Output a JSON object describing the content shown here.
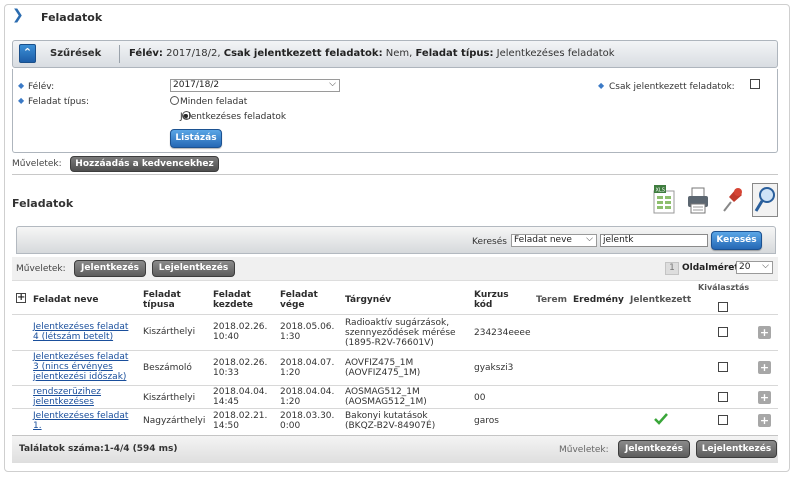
{
  "page": {
    "title": "Feladatok"
  },
  "filters": {
    "header_label": "Szűrések",
    "summary_parts": [
      {
        "k": "Félév:",
        "v": " 2017/18/2, "
      },
      {
        "k": "Csak jelentkezett feladatok:",
        "v": " Nem, "
      },
      {
        "k": "Feladat típus:",
        "v": " Jelentkezéses feladatok"
      }
    ],
    "semester_label": "Félév:",
    "semester_value": "2017/18/2",
    "type_label": "Feladat típus:",
    "type_options": [
      "Minden feladat",
      "Jelentkezéses feladatok"
    ],
    "selected_type_index": 1,
    "only_registered_label": "Csak jelentkezett feladatok:",
    "only_registered_checked": false,
    "list_button": "Listázás"
  },
  "operations_top": {
    "label": "Műveletek:",
    "favorite_button": "Hozzáadás a kedvencekhez"
  },
  "list": {
    "title": "Feladatok",
    "toolbar_icons": [
      "excel-export-icon",
      "print-icon",
      "pin-icon",
      "search-magnifier-icon"
    ],
    "search": {
      "label": "Keresés",
      "field_select": "Feladat neve",
      "query": "jelentk",
      "button": "Keresés"
    },
    "operations_label": "Műveletek:",
    "register_button": "Jelentkezés",
    "unregister_button": "Lejelentkezés",
    "page_number": "1",
    "page_size_label": "Oldalméret",
    "page_size": "20",
    "columns": {
      "name": "Feladat neve",
      "type": [
        "Feladat",
        "típusa"
      ],
      "start": [
        "Feladat",
        "kezdete"
      ],
      "end": [
        "Feladat",
        "vége"
      ],
      "subject": "Tárgynév",
      "course": [
        "Kurzus",
        "kód"
      ],
      "room": "Terem",
      "result": "Eredmény",
      "registered": "Jelentkezett",
      "select": "Kiválasztás"
    },
    "rows": [
      {
        "name": [
          "Jelentkezéses feladat",
          "4 (létszám betelt)"
        ],
        "type": "Kiszárthelyi",
        "start": [
          "2018.02.26.",
          "10:40"
        ],
        "end": [
          "2018.05.06.",
          "1:30"
        ],
        "subject": [
          "Radioaktív sugárzások,",
          "szennyeződések mérése",
          "(1895-R2V-76601V)"
        ],
        "course": "234234eeee",
        "registered": false
      },
      {
        "name": [
          "Jelentkezéses feladat",
          "3 (nincs érvényes",
          "jelentkezési időszak)"
        ],
        "type": "Beszámoló",
        "start": [
          "2018.02.26.",
          "10:33"
        ],
        "end": [
          "2018.04.07.",
          "1:20"
        ],
        "subject": [
          "AOVFIZ475_1M",
          "(AOVFIZ475_1M)"
        ],
        "course": "gyakszi3",
        "registered": false
      },
      {
        "name": [
          "rendszerüzihez",
          "jelentkezéses"
        ],
        "type": "Kiszárthelyi",
        "start": [
          "2018.04.04.",
          "14:45"
        ],
        "end": [
          "2018.04.04.",
          "1:20"
        ],
        "subject": [
          "AOSMAG512_1M",
          "(AOSMAG512_1M)"
        ],
        "course": "00",
        "registered": false
      },
      {
        "name": [
          "Jelentkezéses feladat",
          "1."
        ],
        "type": "Nagyzárthelyi",
        "start": [
          "2018.02.21.",
          "14:50"
        ],
        "end": [
          "2018.03.30.",
          "0:00"
        ],
        "subject": [
          "Bakonyi kutatások",
          "(BKQZ-B2V-84907É)"
        ],
        "course": "garos",
        "registered": true
      }
    ],
    "footer_count": "Találatok száma:1-4/4 (594 ms)",
    "footer_ops_label": "Műveletek:"
  },
  "colors": {
    "accent_blue": "#2568b5",
    "check_green": "#3aa63a",
    "link": "#1a4f9c"
  }
}
